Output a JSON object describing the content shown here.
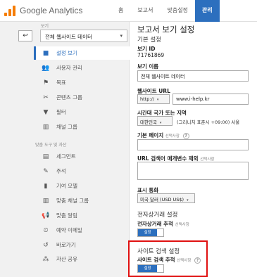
{
  "header": {
    "logo_text": "Google Analytics",
    "tabs": [
      {
        "label": "홈"
      },
      {
        "label": "보고서"
      },
      {
        "label": "맞춤설정"
      },
      {
        "label": "관리"
      }
    ]
  },
  "sidebar": {
    "view_label": "보기",
    "back_glyph": "↩",
    "view_select": "전체 웹사이트 데이터",
    "items": [
      {
        "label": "설정 보기",
        "icon": "document-icon",
        "glyph": "■"
      },
      {
        "label": "사용자 관리",
        "icon": "users-icon",
        "glyph": "👥"
      },
      {
        "label": "목표",
        "icon": "flag-icon",
        "glyph": "⚑"
      },
      {
        "label": "콘텐츠 그룹",
        "icon": "content-group-icon",
        "glyph": "✂"
      },
      {
        "label": "필터",
        "icon": "filter-icon",
        "glyph": "▼"
      },
      {
        "label": "채널 그룹",
        "icon": "channel-group-icon",
        "glyph": "▥"
      },
      {
        "label": "세그먼트",
        "icon": "segment-icon",
        "glyph": "▤"
      },
      {
        "label": "주석",
        "icon": "annotation-icon",
        "glyph": "✎"
      },
      {
        "label": "기여 모델",
        "icon": "attribution-icon",
        "glyph": "▮"
      },
      {
        "label": "맞춤 채널 그룹",
        "icon": "custom-channel-icon",
        "glyph": "▥"
      },
      {
        "label": "맞춤 알림",
        "icon": "alert-icon",
        "glyph": "📢"
      },
      {
        "label": "예약 이메일",
        "icon": "email-icon",
        "glyph": "⏲"
      },
      {
        "label": "바로가기",
        "icon": "shortcut-icon",
        "glyph": "↺"
      },
      {
        "label": "자산 공유",
        "icon": "share-icon",
        "glyph": "⁂"
      }
    ],
    "section_label": "맞춤 도구 및 자산"
  },
  "main": {
    "title": "보고서 보기 설정",
    "basic_settings": "기본 설정",
    "view_id_label": "보기 ID",
    "view_id_value": "71761869",
    "view_name_label": "보기 이름",
    "view_name_value": "전체 웹사이트 데이터",
    "website_url_label": "웹사이트 URL",
    "protocol": "http://",
    "url_value": "www.i-help.kr",
    "timezone_label": "시간대 국가 또는 지역",
    "country": "대한민국",
    "timezone_value": "(그리니치 표준시 +09:00) 서울",
    "default_page_label": "기본 페이지",
    "optional": "선택사항",
    "exclude_query_label": "URL 검색어 매개변수 제외",
    "currency_label": "표시 통화",
    "currency_value": "미국 달러 (USD US$)",
    "ecommerce_heading": "전자상거래 설정",
    "ecommerce_tracking_label": "전자상거래 추적",
    "toggle_on_label": "설정",
    "site_search_heading": "사이트 검색 설정",
    "site_search_tracking_label": "사이트 검색 추적"
  }
}
